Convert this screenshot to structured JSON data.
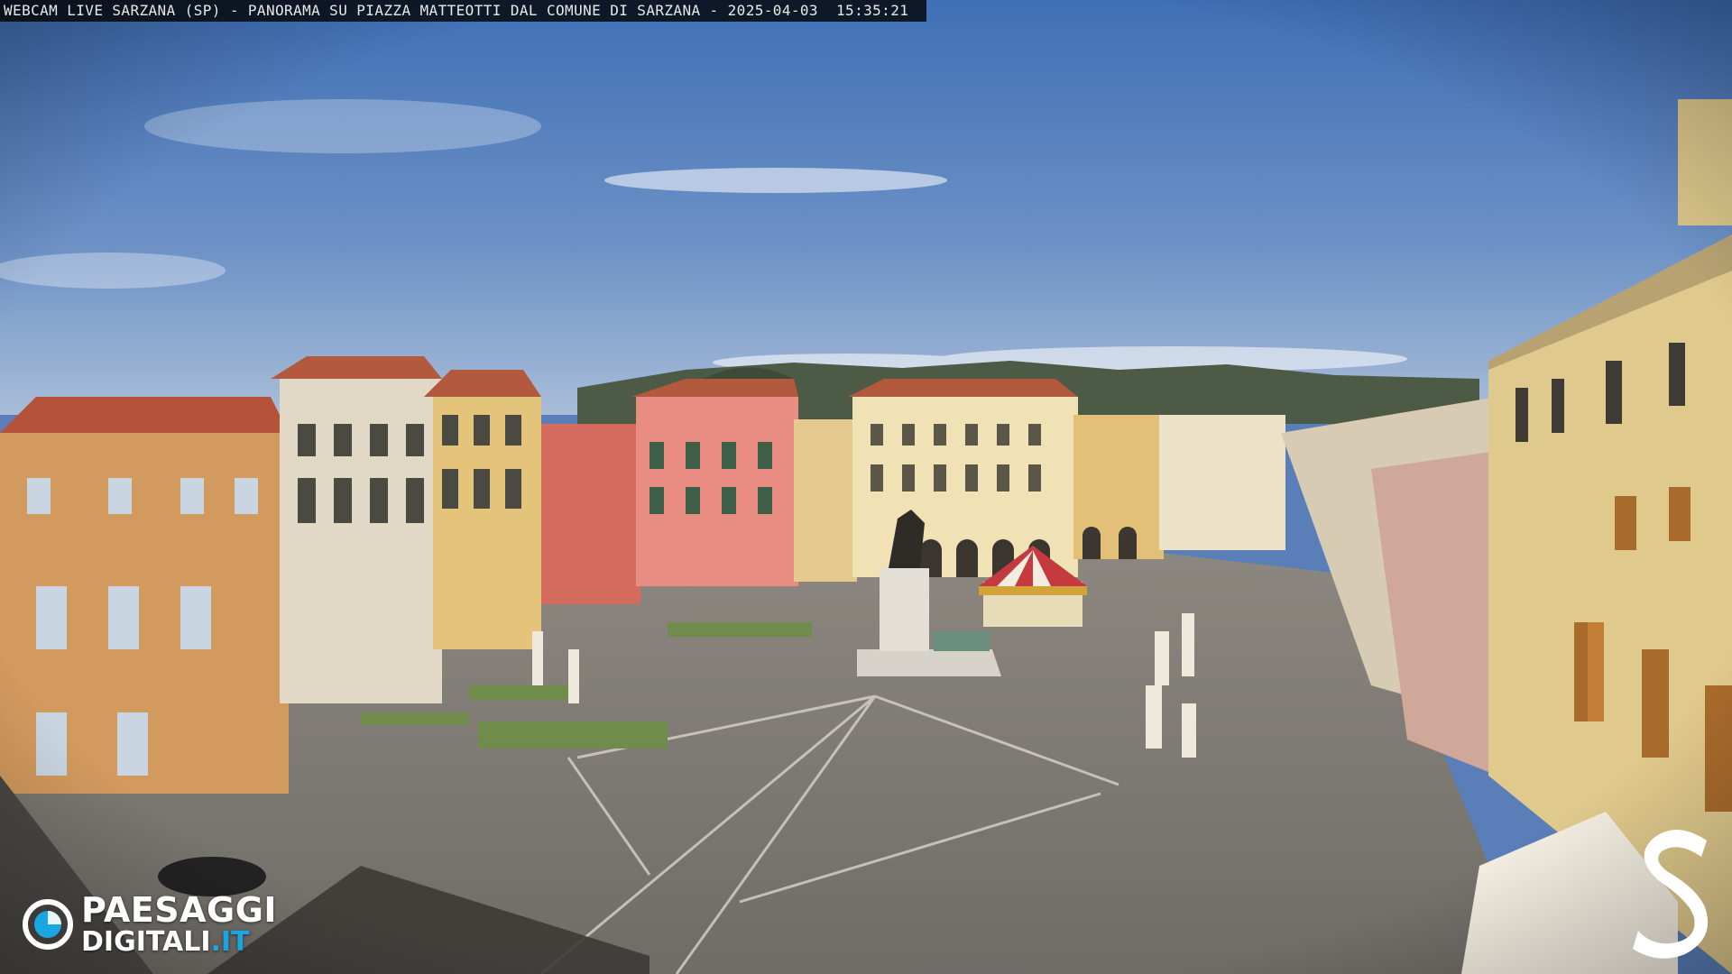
{
  "overlay": {
    "title": "WEBCAM LIVE SARZANA (SP) - PANORAMA SU PIAZZA MATTEOTTI DAL COMUNE DI SARZANA - 2025-04-03  15:35:21"
  },
  "brand": {
    "line1": "PAESAGGI",
    "line2_main": "DIGITALI",
    "line2_suffix": ".IT",
    "accent_color": "#1aa6e0"
  },
  "corner_logo": {
    "icon": "s-letter-logo"
  },
  "scene": {
    "description_icons": [
      "sky",
      "clouds",
      "hills",
      "buildings",
      "piazza",
      "statue",
      "carousel",
      "cafe-umbrellas"
    ]
  }
}
